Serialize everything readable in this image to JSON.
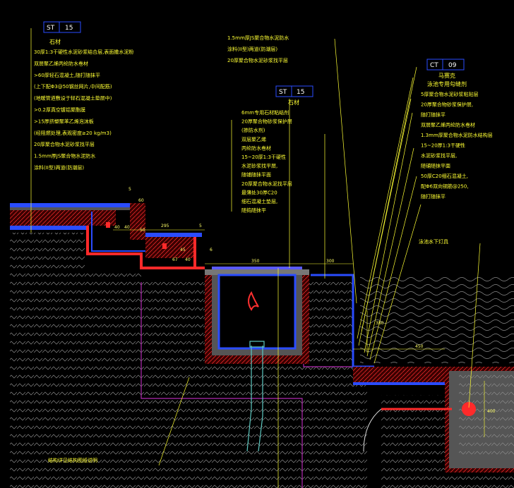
{
  "colors": {
    "background": "#000000",
    "leader": "#ffff33",
    "waterproof": "#2a4cff",
    "mortar": "#ff2a2a",
    "concrete_hatch": "#9a9a9a",
    "structure_outline": "#b02ab0",
    "tag_box": "#2a4cff",
    "pool_water": "#6a6a6a",
    "pipe": "#5ec8c0"
  },
  "tags": {
    "st_left": {
      "code": "ST",
      "num": "15",
      "name": "石材"
    },
    "st_mid": {
      "code": "ST",
      "num": "15",
      "name": "石材"
    },
    "ct_right": {
      "code": "CT",
      "num": "09",
      "name": "马赛克",
      "subname": "泳池专用勾缝剂"
    }
  },
  "notes_left": [
    "30厚1:3干硬性水泥砂浆结合层,表面撒水泥粉",
    "双层聚乙烯丙纶防水卷材",
    ">60厚轻石混凝土,随打随抹平",
    "(上下配Φ3@50钢丝网片,中间配筋)",
    "(地暖管道敷设于轻石混凝土垫层中)",
    ">0.2厚真空镀铝聚酯膜",
    ">15厚挤塑聚苯乙烯泡沫板",
    "(经阻燃处理,表观密度≥20 kg/m3)",
    "20厚聚合物水泥砂浆找平层",
    "1.5mm厚JS聚合物水泥防水",
    "涂料(II型)两道(防潮层)"
  ],
  "notes_mid_top": [
    "1.5mm厚JS聚合物水泥防水",
    "涂料(II型)两道(防潮层)",
    "20厚聚合物水泥砂浆找平层"
  ],
  "notes_mid": [
    "6mm专用石材粘结剂",
    "20厚聚合物砂浆保护层",
    "(掺防水剂)",
    "双层聚乙烯",
    "丙纶防水卷材",
    "15~20厚1:3干硬性",
    "水泥砂浆找平层,",
    "随铺随抹平面",
    "20厚聚合物水泥找平层",
    "最薄处30厚C20",
    "细石混凝土垫层,",
    "随捣随抹平"
  ],
  "notes_right": [
    "5厚聚合物水泥砂浆粘贴层",
    "20厚聚合物砂浆保护层,",
    "随打随抹平",
    "双层聚乙烯丙纶防水卷材",
    "1.3mm厚聚合物水泥防水结构层",
    "15~20厚1:3干硬性",
    "水泥砂浆找平层,",
    "随铺随抹平面",
    "50厚C20细石混凝土,",
    "配Φ6双向钢筋@250,",
    "随打随抹平"
  ],
  "pool_label": "泳池水下灯具",
  "structure_label": "结构详见结构图纸说明",
  "dims": {
    "d5a": "5",
    "d5b": "5",
    "d40a": "40",
    "d40b": "40",
    "d40c": "40",
    "d50": "50",
    "d295": "295",
    "d6": "6",
    "d45": "45",
    "d67": "67",
    "d350": "350",
    "d300": "300",
    "d380": "380",
    "d450": "450",
    "d400": "400",
    "d60": "60"
  }
}
